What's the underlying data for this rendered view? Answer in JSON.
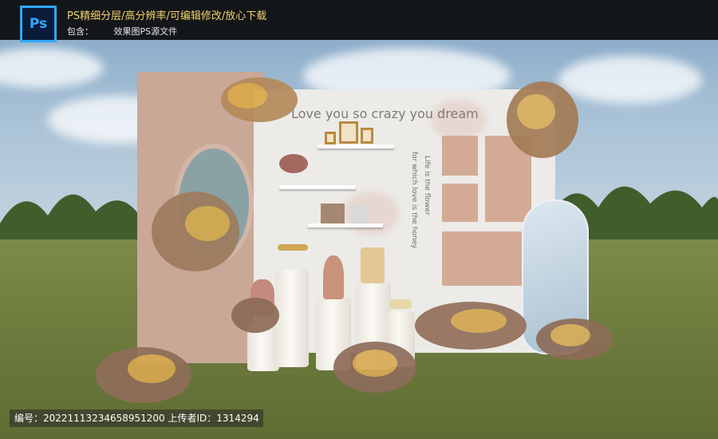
{
  "banner": {
    "app_icon_label": "Ps",
    "title": "PS精细分层/高分辨率/可编辑修改/放心下载",
    "contents_label": "包含：",
    "contents_value": "效果图PS源文件"
  },
  "scene": {
    "headline": "Love you so crazy you dream",
    "vertical_text_1": "Life is the flower",
    "vertical_text_2": "for which love is the honey"
  },
  "footer": {
    "text": "编号：20221113234658951200 上传者ID：1314294"
  },
  "colors": {
    "banner_bg": "#0a0a0a",
    "banner_title": "#f3d36b",
    "panel_pink": "#c9a897",
    "board": "#ecebe8",
    "lawn": "#6f7d3f"
  }
}
